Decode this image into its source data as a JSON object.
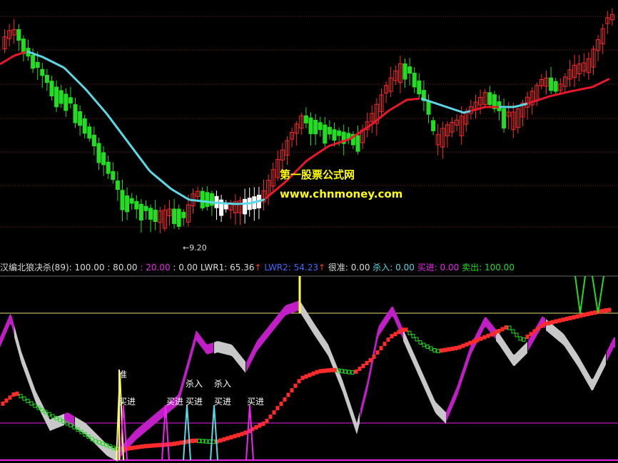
{
  "colors": {
    "bg": "#000000",
    "up": "#ff2a2a",
    "down": "#22dd22",
    "ma_up": "#e8182b",
    "ma_down": "#5ad8e6",
    "white": "#ffffff",
    "grid": "#7a1d1d",
    "yellow": "#ffff00",
    "magenta": "#ee22ee",
    "purple_fill": "#c21ec8",
    "gray_fill": "#c8c8c8"
  },
  "watermark": {
    "line1": "第一股票公式网",
    "line2": "www.chnmoney.com"
  },
  "low_marker": "←9.20",
  "legend": {
    "name": "汉编北狼决杀(89)",
    "p1": ": 100.00",
    "p2": ": 80.00",
    "p3": ": 20.00",
    "p4": ": 0.00",
    "lwr1": "LWR1: 65.36",
    "lwr1_arrow": "↑",
    "lwr2": "LWR2: 54.23",
    "lwr2_arrow": "↑",
    "hen_zhun": "很准: 0.00",
    "sha_ru": "杀入: 0.00",
    "mai_jin": "买进: 0.00",
    "mai_chu": "卖出: 100.00"
  },
  "signal_labels": {
    "zhun": "准",
    "maijin": "买进",
    "sharu": "杀入"
  },
  "chart_data": [
    {
      "type": "candlestick",
      "low_label": "9.20",
      "ma_series": {
        "up_color": "#e8182b",
        "down_color": "#5ad8e6"
      }
    },
    {
      "type": "line",
      "title": "汉编北狼决杀(89)",
      "series": [
        {
          "name": "LWR1",
          "last": 65.36
        },
        {
          "name": "LWR2",
          "last": 54.23
        }
      ],
      "reference_levels": [
        100,
        80,
        20,
        0
      ],
      "signals": {
        "很准": 0.0,
        "杀入": 0.0,
        "买进": 0.0,
        "卖出": 100.0
      }
    }
  ]
}
